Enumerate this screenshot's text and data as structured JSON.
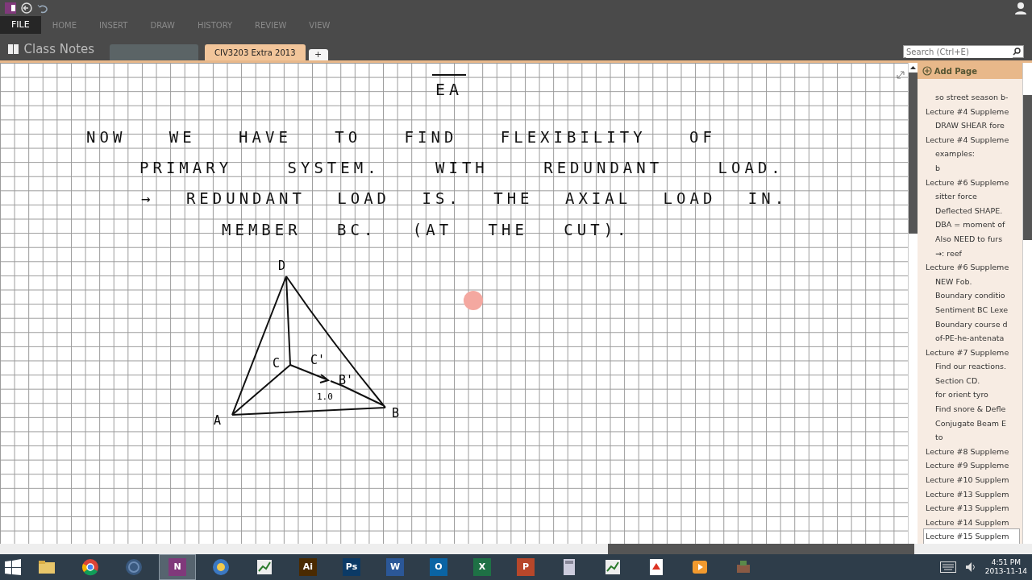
{
  "ribbon": {
    "file_tab": "FILE",
    "tabs": [
      "HOME",
      "INSERT",
      "DRAW",
      "HISTORY",
      "REVIEW",
      "VIEW"
    ]
  },
  "notebook": {
    "name": "Class Notes",
    "sections": [
      {
        "selected": false
      },
      {
        "label": "CIV3203 Extra 2013",
        "selected": true
      }
    ],
    "add_tab": "+"
  },
  "search": {
    "placeholder": "Search (Ctrl+E)"
  },
  "note": {
    "formula": "EA",
    "lines": [
      "NOW WE HAVE TO FIND FLEXIBILITY OF",
      "PRIMARY SYSTEM. WITH REDUNDANT LOAD.",
      "→ REDUNDANT LOAD IS. THE AXIAL LOAD IN.",
      "MEMBER BC. (AT THE CUT)."
    ],
    "diagram_labels": [
      "D",
      "C",
      "C'",
      "B'",
      "1.0",
      "A",
      "B"
    ]
  },
  "pages": {
    "add_label": "Add Page",
    "items": [
      {
        "children": [
          {
            "title": "so street season b-",
            "selected": false
          }
        ]
      },
      {
        "title": "Lecture #4 Suppleme",
        "selected": false,
        "children": [
          {
            "title": "DRAW SHEAR fore",
            "selected": false
          }
        ]
      },
      {
        "title": "Lecture #4 Suppleme",
        "selected": false,
        "children": [
          {
            "title": "examples:",
            "selected": false
          },
          {
            "title": "b",
            "selected": false
          }
        ]
      },
      {
        "title": "Lecture #6 Suppleme",
        "selected": false,
        "children": [
          {
            "title": "sitter force",
            "selected": false
          },
          {
            "title": "Deflected SHAPE.",
            "selected": false
          },
          {
            "title": "DBA = moment of",
            "selected": false
          },
          {
            "title": "Also NEED to furs",
            "selected": false
          },
          {
            "title": "→: reef",
            "selected": false
          }
        ]
      },
      {
        "title": "Lecture #6 Suppleme",
        "selected": false,
        "children": [
          {
            "title": "NEW Fob.",
            "selected": false
          },
          {
            "title": "Boundary conditio",
            "selected": false
          },
          {
            "title": "Sentiment BC Lexe",
            "selected": false
          },
          {
            "title": "Boundary course d",
            "selected": false
          },
          {
            "title": "of-PE-he-antenata",
            "selected": false
          }
        ]
      },
      {
        "title": "Lecture #7 Suppleme",
        "selected": false,
        "children": [
          {
            "title": "Find our reactions.",
            "selected": false
          },
          {
            "title": "Section CD.",
            "selected": false
          },
          {
            "title": "for orient tyro",
            "selected": false
          },
          {
            "title": "Find snore & Defle",
            "selected": false
          },
          {
            "title": "Conjugate Beam E",
            "selected": false
          },
          {
            "title": "to",
            "selected": false
          }
        ]
      },
      {
        "title": "Lecture #8 Suppleme",
        "selected": false
      },
      {
        "title": "Lecture #9 Suppleme",
        "selected": false
      },
      {
        "title": "Lecture #10 Supplem",
        "selected": false
      },
      {
        "title": "Lecture #13 Supplem",
        "selected": false
      },
      {
        "title": "Lecture #13 Supplem",
        "selected": false
      },
      {
        "title": "Lecture #14 Supplem",
        "selected": false
      },
      {
        "title": "Lecture #15 Supplem",
        "selected": true
      }
    ]
  },
  "taskbar": {
    "apps": [
      {
        "kind": "folder",
        "active": false
      },
      {
        "kind": "browser",
        "active": false
      },
      {
        "kind": "disc",
        "active": false
      },
      {
        "kind": "tile",
        "label": "N",
        "color": "#80397b",
        "active": true
      },
      {
        "kind": "globe",
        "active": false
      },
      {
        "kind": "chart",
        "active": false
      },
      {
        "kind": "tile",
        "label": "Ai",
        "color": "#4a2a00",
        "active": false
      },
      {
        "kind": "tile",
        "label": "Ps",
        "color": "#0b3a66",
        "active": false
      },
      {
        "kind": "tile",
        "label": "W",
        "color": "#2b5797",
        "active": false
      },
      {
        "kind": "tile",
        "label": "O",
        "color": "#0a64a4",
        "active": false
      },
      {
        "kind": "tile",
        "label": "X",
        "color": "#1e7145",
        "active": false
      },
      {
        "kind": "tile",
        "label": "P",
        "color": "#b7472a",
        "active": false
      },
      {
        "kind": "calc",
        "active": false
      },
      {
        "kind": "chart",
        "active": false
      },
      {
        "kind": "doc",
        "active": false
      },
      {
        "kind": "media",
        "active": false
      },
      {
        "kind": "tool",
        "active": false
      }
    ],
    "time": "4:51 PM",
    "date": "2013-11-14"
  }
}
